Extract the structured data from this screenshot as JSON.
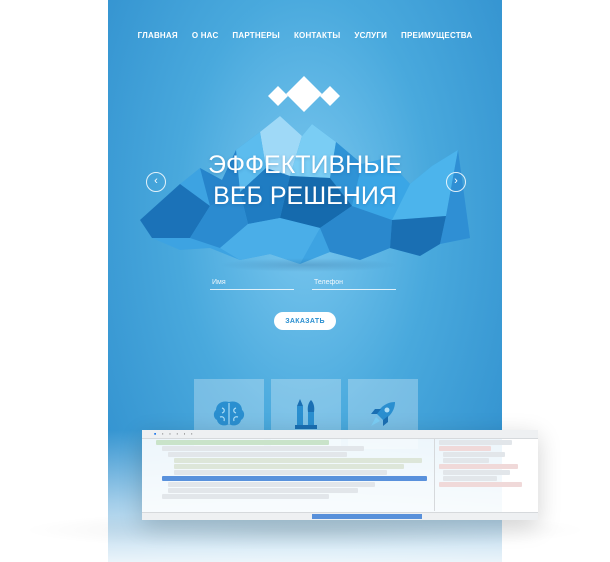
{
  "nav": {
    "items": [
      {
        "label": "ГЛАВНАЯ"
      },
      {
        "label": "О НАС"
      },
      {
        "label": "ПАРТНЕРЫ"
      },
      {
        "label": "КОНТАКТЫ"
      },
      {
        "label": "УСЛУГИ"
      },
      {
        "label": "ПРЕИМУЩЕСТВА"
      }
    ]
  },
  "hero": {
    "headline_line1": "ЭФФЕКТИВНЫЕ",
    "headline_line2": "ВЕБ РЕШЕНИЯ",
    "prev_arrow": "‹",
    "next_arrow": "›"
  },
  "form": {
    "name_placeholder": "Имя",
    "phone_placeholder": "Телефон",
    "order_label": "ЗАКАЗАТЬ"
  },
  "cards": [
    {
      "icon": "brain-icon"
    },
    {
      "icon": "pencil-brush-icon"
    },
    {
      "icon": "rocket-icon"
    }
  ],
  "colors": {
    "accent": "#2a8fd0",
    "background": "#49a9dd",
    "mountain_light": "#5ab9ec",
    "mountain_dark": "#1565a8"
  }
}
